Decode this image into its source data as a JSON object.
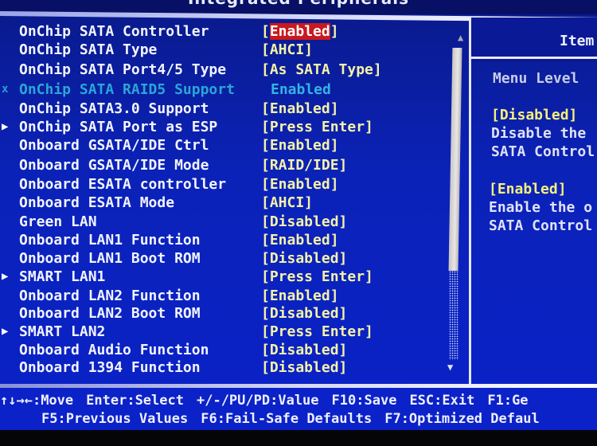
{
  "window": {
    "title": "Integrated Peripherals"
  },
  "settings": [
    {
      "marker": "",
      "label": "OnChip SATA Controller",
      "value": "[Enabled]",
      "selected": true,
      "enabled": true
    },
    {
      "marker": "",
      "label": "OnChip SATA Type",
      "value": "[AHCI]",
      "selected": false,
      "enabled": true
    },
    {
      "marker": "",
      "label": "OnChip SATA Port4/5 Type",
      "value": "[As SATA Type]",
      "selected": false,
      "enabled": true
    },
    {
      "marker": "x",
      "label": "OnChip SATA RAID5 Support",
      "value": "Enabled",
      "selected": false,
      "enabled": false
    },
    {
      "marker": "",
      "label": "OnChip SATA3.0 Support",
      "value": "[Enabled]",
      "selected": false,
      "enabled": true
    },
    {
      "marker": "submenu",
      "label": "OnChip SATA Port as ESP",
      "value": "[Press Enter]",
      "selected": false,
      "enabled": true
    },
    {
      "marker": "",
      "label": "Onboard GSATA/IDE Ctrl",
      "value": "[Enabled]",
      "selected": false,
      "enabled": true
    },
    {
      "marker": "",
      "label": "Onboard GSATA/IDE Mode",
      "value": "[RAID/IDE]",
      "selected": false,
      "enabled": true
    },
    {
      "marker": "",
      "label": "Onboard ESATA controller",
      "value": "[Enabled]",
      "selected": false,
      "enabled": true
    },
    {
      "marker": "",
      "label": "Onboard ESATA Mode",
      "value": "[AHCI]",
      "selected": false,
      "enabled": true
    },
    {
      "marker": "",
      "label": "Green LAN",
      "value": "[Disabled]",
      "selected": false,
      "enabled": true
    },
    {
      "marker": "",
      "label": "Onboard LAN1 Function",
      "value": "[Enabled]",
      "selected": false,
      "enabled": true
    },
    {
      "marker": "",
      "label": "Onboard LAN1 Boot ROM",
      "value": "[Disabled]",
      "selected": false,
      "enabled": true
    },
    {
      "marker": "submenu",
      "label": "SMART LAN1",
      "value": "[Press Enter]",
      "selected": false,
      "enabled": true
    },
    {
      "marker": "",
      "label": "Onboard LAN2 Function",
      "value": "[Enabled]",
      "selected": false,
      "enabled": true
    },
    {
      "marker": "",
      "label": "Onboard LAN2 Boot ROM",
      "value": "[Disabled]",
      "selected": false,
      "enabled": true
    },
    {
      "marker": "submenu",
      "label": "SMART LAN2",
      "value": "[Press Enter]",
      "selected": false,
      "enabled": true
    },
    {
      "marker": "",
      "label": "Onboard Audio Function",
      "value": "[Disabled]",
      "selected": false,
      "enabled": true
    },
    {
      "marker": "",
      "label": "Onboard 1394 Function",
      "value": "[Disabled]",
      "selected": false,
      "enabled": true
    }
  ],
  "markers": {
    "submenu": "▶",
    "x": "x"
  },
  "scrollbar": {
    "up_icon": "▲",
    "down_icon": "▼",
    "position_fraction": 0.0,
    "visible_fraction": 0.7
  },
  "help": {
    "title": "Item",
    "menu_level": "Menu Level",
    "lines": [
      {
        "text": "[Disabled]",
        "style": "yellow"
      },
      {
        "text": "Disable the",
        "style": "body"
      },
      {
        "text": "SATA Control",
        "style": "body"
      },
      {
        "text": "",
        "style": "body"
      },
      {
        "text": "[Enabled]",
        "style": "yellow"
      },
      {
        "text": "Enable the o",
        "style": "body"
      },
      {
        "text": "SATA Control",
        "style": "body"
      }
    ]
  },
  "footer": {
    "line1": [
      {
        "key": "↑↓→←",
        "action": ":Move"
      },
      {
        "key": "Enter",
        "action": ":Select"
      },
      {
        "key": "+/-/PU/PD",
        "action": ":Value"
      },
      {
        "key": "F10",
        "action": ":Save"
      },
      {
        "key": "ESC",
        "action": ":Exit"
      },
      {
        "key": "F1",
        "action": ":Ge"
      }
    ],
    "line2": [
      {
        "key": "F5",
        "action": ":Previous Values"
      },
      {
        "key": "F6",
        "action": ":Fail-Safe Defaults"
      },
      {
        "key": "F7",
        "action": ":Optimized Defaul"
      }
    ]
  },
  "colors": {
    "background": "#0b22c8",
    "label": "#f2f4ff",
    "value": "#f5f2a8",
    "disabled": "#2aa6d6",
    "highlight": "#c81a1e"
  }
}
